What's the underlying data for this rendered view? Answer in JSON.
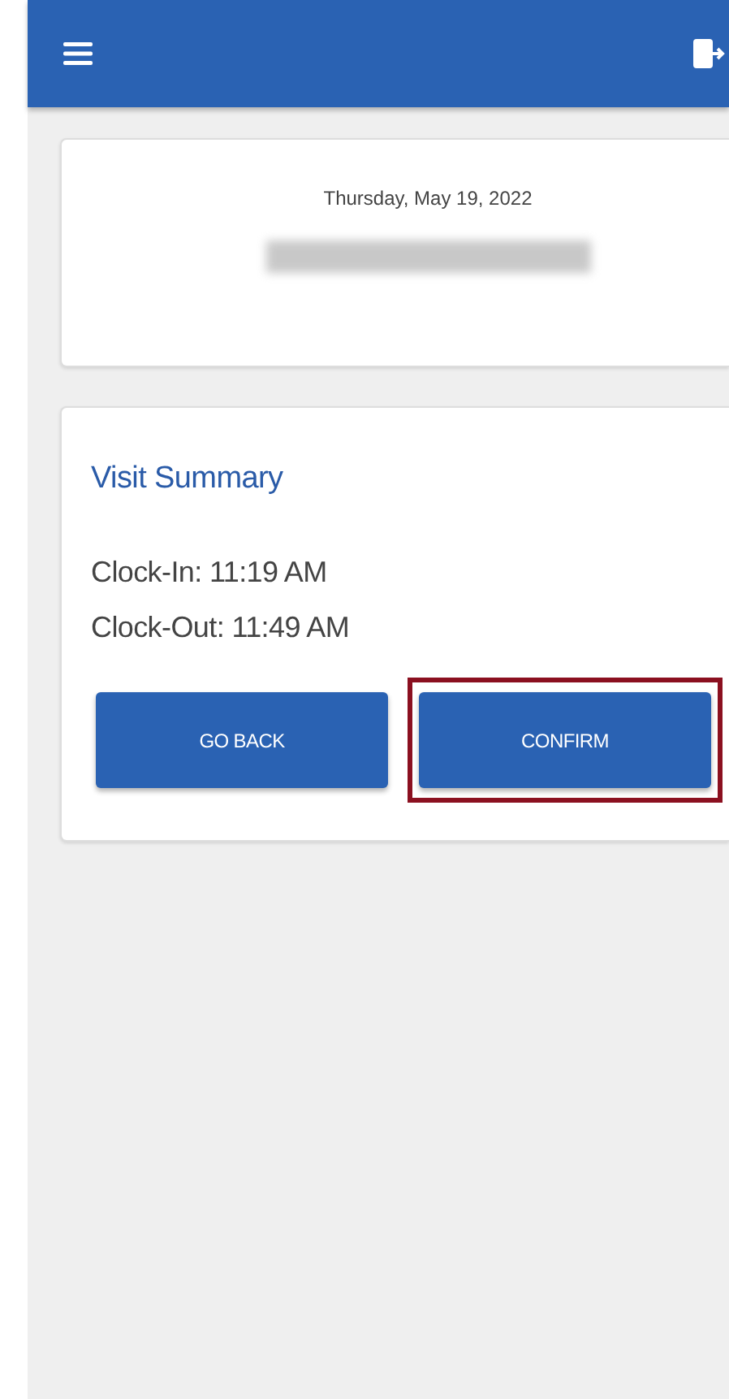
{
  "header": {
    "menu": true,
    "logout": true
  },
  "date_card": {
    "date": "Thursday, May 19, 2022",
    "redacted": true
  },
  "summary": {
    "title": "Visit Summary",
    "lines": [
      "Clock-In: 11:19 AM",
      "Clock-Out: 11:49 AM"
    ],
    "buttons": [
      {
        "label": "GO BACK",
        "highlighted": false
      },
      {
        "label": "CONFIRM",
        "highlighted": true
      }
    ]
  }
}
